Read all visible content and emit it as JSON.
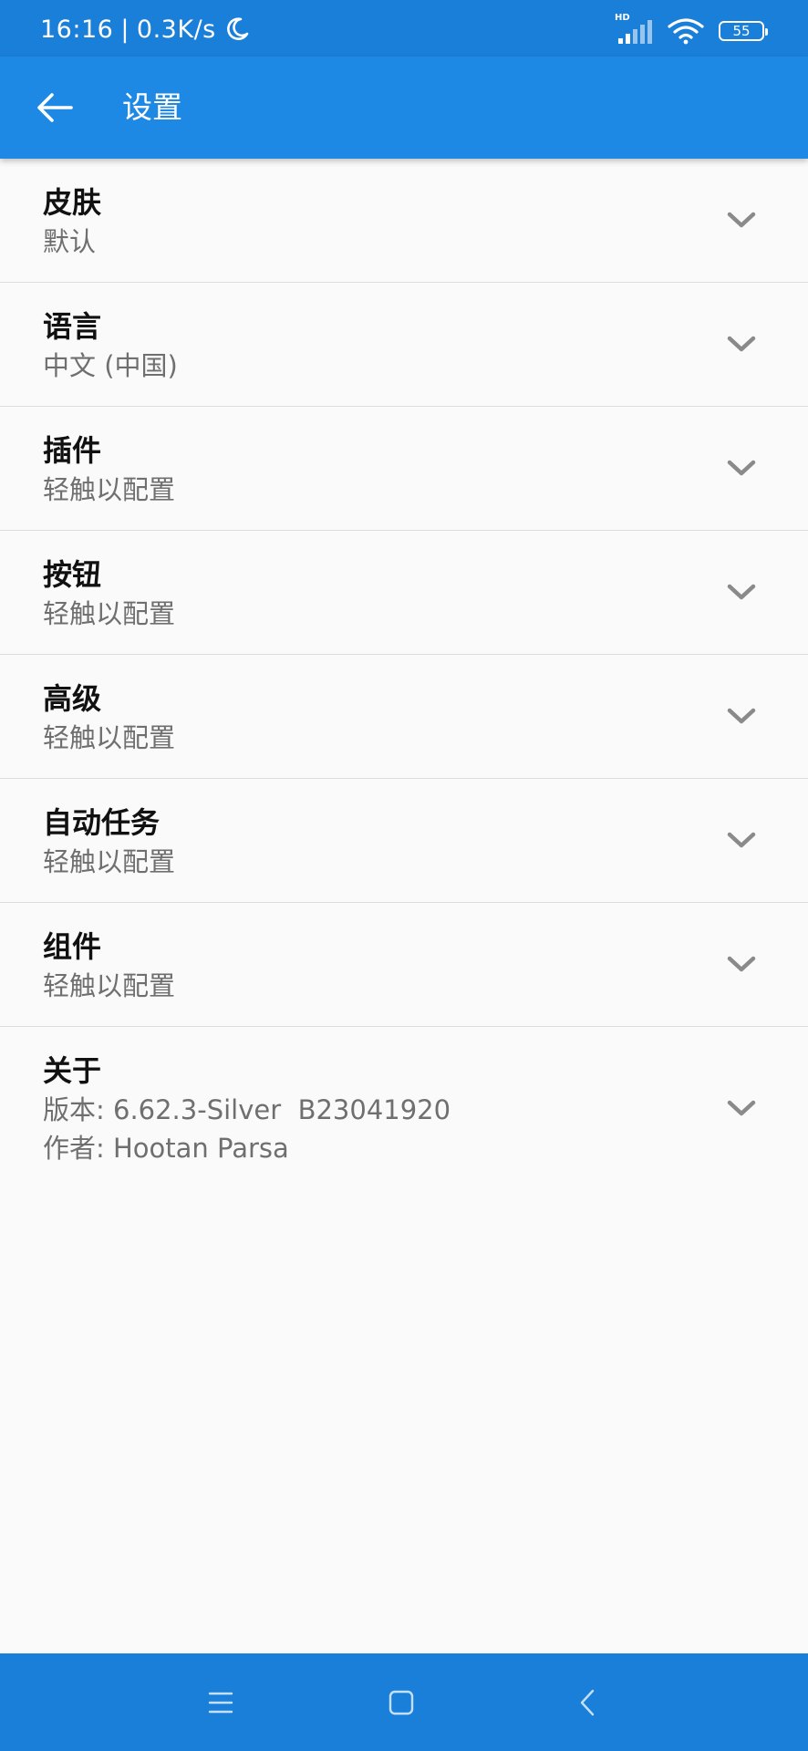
{
  "status_bar": {
    "time": "16:16",
    "separator": "|",
    "speed": "0.3K/s",
    "network_badge": "HD",
    "battery": "55",
    "icons": [
      "moon-icon",
      "signal-icon",
      "wifi-icon",
      "battery-icon"
    ]
  },
  "app_bar": {
    "title": "设置",
    "back_icon": "arrow-left-icon"
  },
  "settings": {
    "items": [
      {
        "title": "皮肤",
        "subtitle": "默认"
      },
      {
        "title": "语言",
        "subtitle": "中文 (中国)"
      },
      {
        "title": "插件",
        "subtitle": "轻触以配置"
      },
      {
        "title": "按钮",
        "subtitle": "轻触以配置"
      },
      {
        "title": "高级",
        "subtitle": "轻触以配置"
      },
      {
        "title": "自动任务",
        "subtitle": "轻触以配置"
      },
      {
        "title": "组件",
        "subtitle": "轻触以配置"
      },
      {
        "title": "关于",
        "subtitle": "版本: 6.62.3-Silver  B23041920",
        "subtitle2": "作者: Hootan Parsa"
      }
    ]
  },
  "nav_bar": {
    "icons": [
      "menu-icon",
      "home-icon",
      "back-icon"
    ]
  },
  "colors": {
    "status_bar": "#1a7fd9",
    "app_bar": "#1e88e5",
    "background": "#fafafa",
    "title_text": "#111111",
    "subtitle_text": "#6f6f6f",
    "divider": "#dcdcdc",
    "chevron": "#8a8a8a"
  }
}
